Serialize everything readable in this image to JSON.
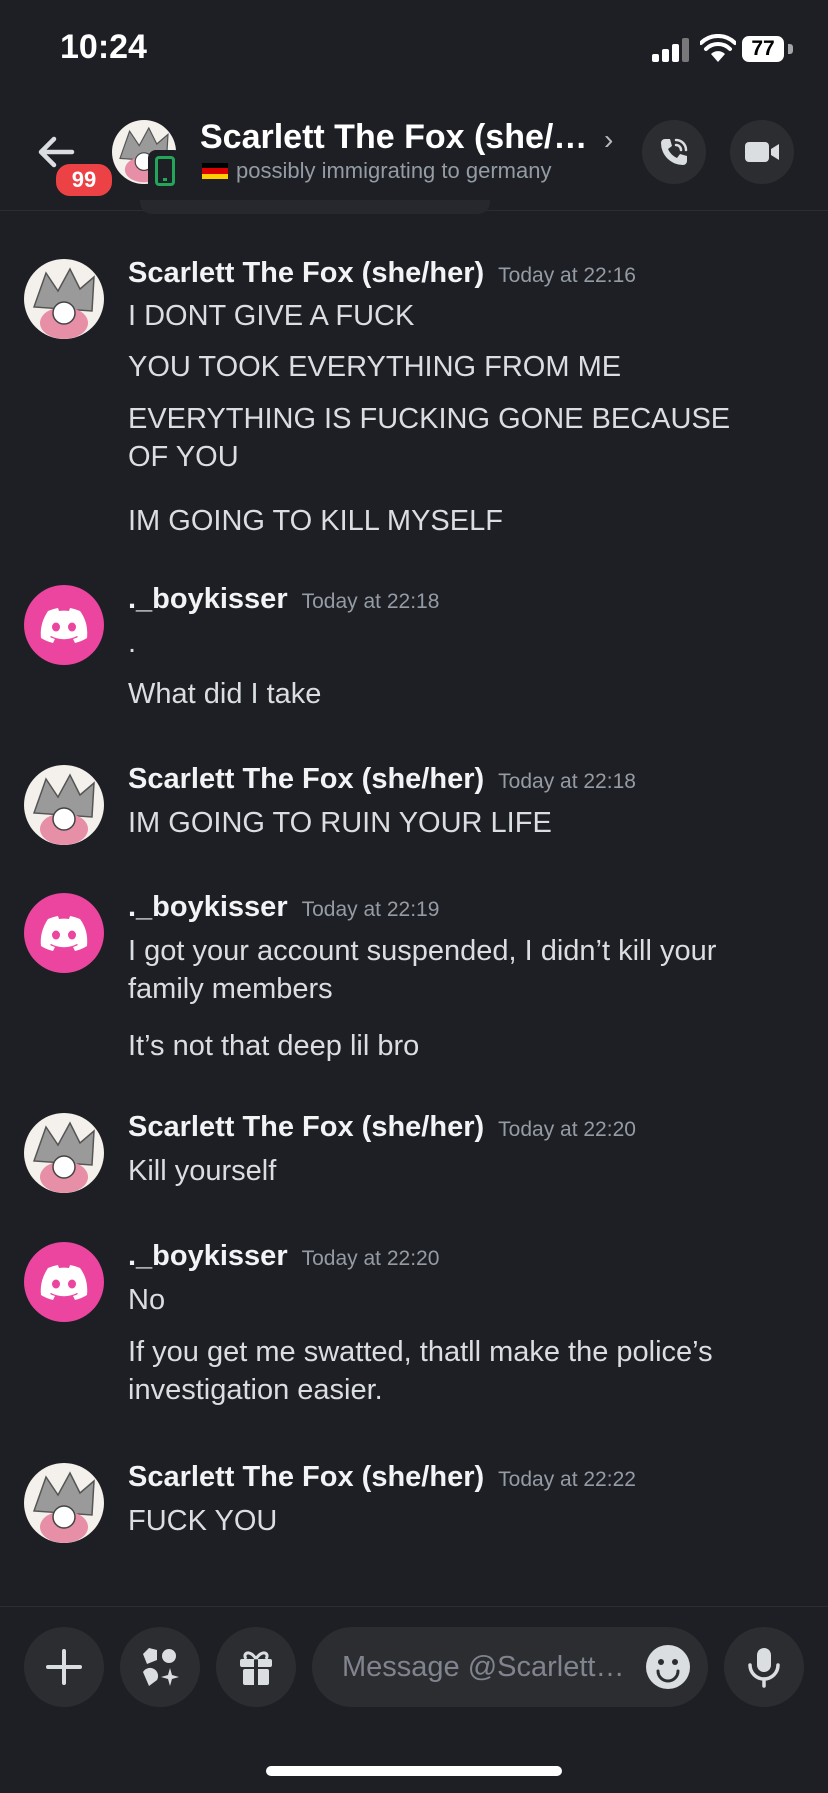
{
  "status_bar": {
    "time": "10:24",
    "battery": "77"
  },
  "header": {
    "unread_count": "99",
    "title": "Scarlett The Fox (she/…",
    "status_text": "possibly immigrating to germany",
    "flag_icon": "germany-flag-icon"
  },
  "messages": [
    {
      "author": "Scarlett The Fox (she/her)",
      "timestamp": "Today at 22:16",
      "avatar": "fox-avatar",
      "lines": [
        "I DONT GIVE A FUCK",
        "YOU TOOK EVERYTHING FROM ME",
        "EVERYTHING IS FUCKING GONE BECAUSE OF YOU",
        "IM GOING TO KILL MYSELF"
      ]
    },
    {
      "author": "._boykisser",
      "timestamp": "Today at 22:18",
      "avatar": "discord-default-avatar",
      "lines": [
        ".",
        "What did I take"
      ]
    },
    {
      "author": "Scarlett The Fox (she/her)",
      "timestamp": "Today at 22:18",
      "avatar": "fox-avatar",
      "lines": [
        "IM GOING TO RUIN YOUR LIFE"
      ]
    },
    {
      "author": "._boykisser",
      "timestamp": "Today at 22:19",
      "avatar": "discord-default-avatar",
      "lines": [
        "I got your account suspended, I didn’t kill your family members",
        "It’s not that deep lil bro"
      ]
    },
    {
      "author": "Scarlett The Fox (she/her)",
      "timestamp": "Today at 22:20",
      "avatar": "fox-avatar",
      "lines": [
        "Kill yourself"
      ]
    },
    {
      "author": "._boykisser",
      "timestamp": "Today at 22:20",
      "avatar": "discord-default-avatar",
      "lines": [
        "No",
        "If you get me swatted, thatll make the police’s investigation easier."
      ]
    },
    {
      "author": "Scarlett The Fox (she/her)",
      "timestamp": "Today at 22:22",
      "avatar": "fox-avatar",
      "lines": [
        "FUCK YOU"
      ]
    }
  ],
  "composer": {
    "placeholder": "Message @Scarlett…"
  },
  "colors": {
    "background": "#1e1f24",
    "discord_pink": "#eb459f",
    "badge_red": "#ed4245",
    "online_green": "#23a55a"
  }
}
